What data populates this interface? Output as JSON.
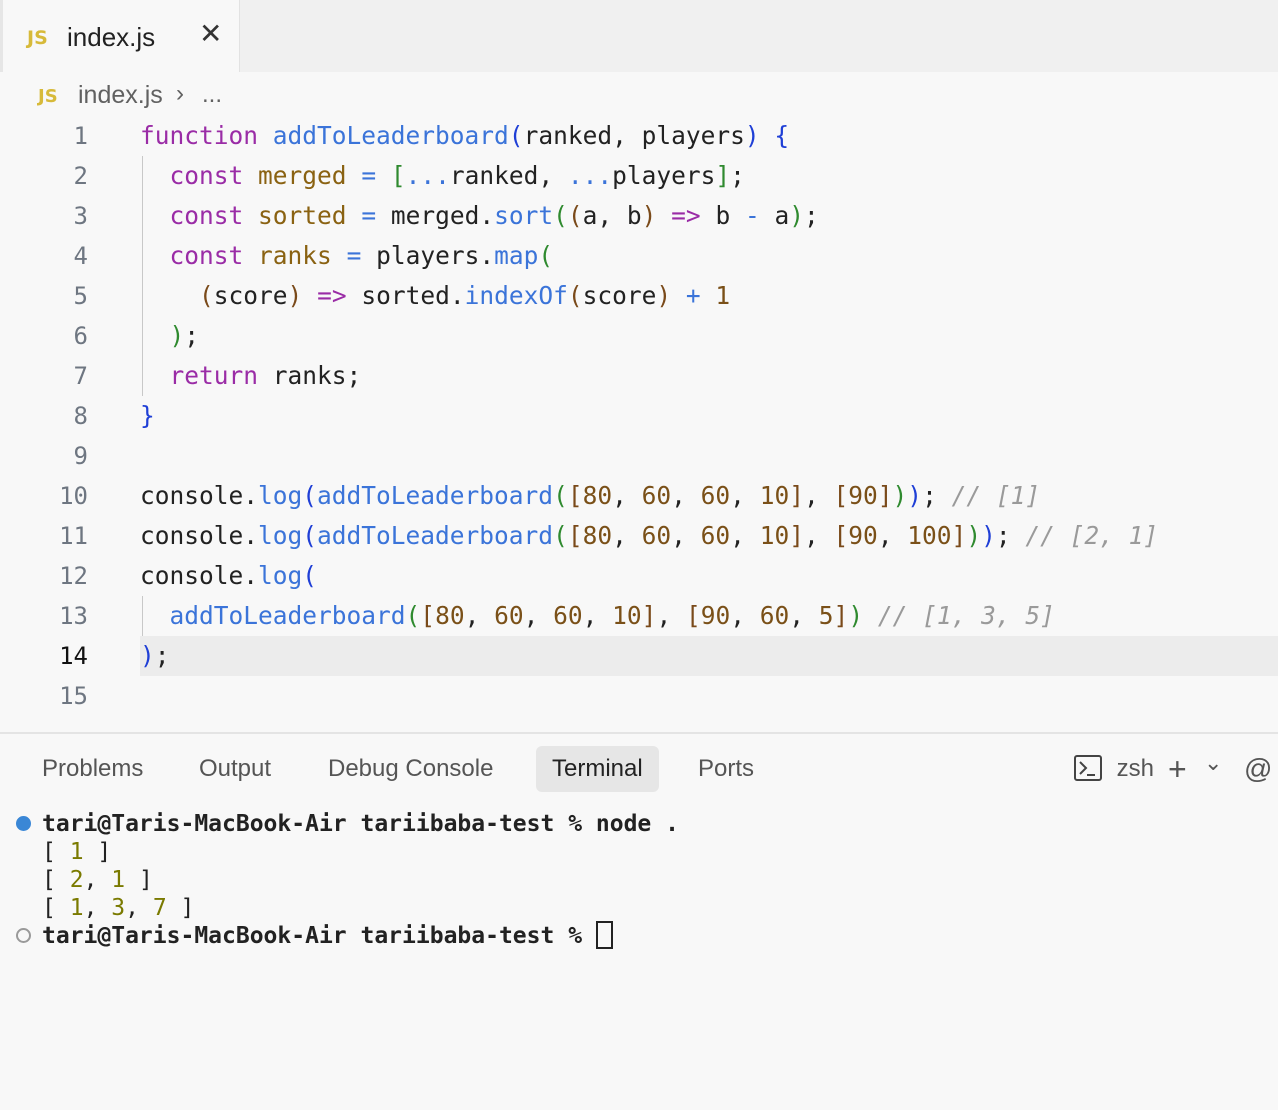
{
  "tab": {
    "badge": "JS",
    "label": "index.js",
    "close": "✕"
  },
  "breadcrumb": {
    "badge": "JS",
    "file": "index.js",
    "separator": "›",
    "more": "..."
  },
  "editor": {
    "active_line": "14",
    "lines": [
      {
        "n": "1"
      },
      {
        "n": "2"
      },
      {
        "n": "3"
      },
      {
        "n": "4"
      },
      {
        "n": "5"
      },
      {
        "n": "6"
      },
      {
        "n": "7"
      },
      {
        "n": "8"
      },
      {
        "n": "9"
      },
      {
        "n": "10"
      },
      {
        "n": "11"
      },
      {
        "n": "12"
      },
      {
        "n": "13"
      },
      {
        "n": "14"
      },
      {
        "n": "15"
      }
    ],
    "code": {
      "l1": {
        "kw": "function",
        "fn": "addToLeaderboard",
        "p1": "(",
        "args": "ranked, players",
        "p2": ")",
        "sp": " ",
        "b": "{"
      },
      "l2": {
        "kw": "const",
        "var": "merged",
        "eq": " = ",
        "b1": "[",
        "spread1": "...",
        "a1": "ranked, ",
        "spread2": "...",
        "a2": "players",
        "b2": "]",
        "end": ";"
      },
      "l3": {
        "kw": "const",
        "var": "sorted",
        "eq": " = ",
        "obj": "merged.",
        "fn": "sort",
        "p1": "(",
        "p2": "(",
        "args": "a, b",
        "p3": ")",
        "arrow": " => ",
        "expr1": "b ",
        "minus": "-",
        "expr2": " a",
        "p4": ")",
        "end": ";"
      },
      "l4": {
        "kw": "const",
        "var": "ranks",
        "eq": " = ",
        "obj": "players.",
        "fn": "map",
        "p1": "("
      },
      "l5": {
        "p1": "(",
        "arg": "score",
        "p2": ")",
        "arrow": " => ",
        "obj": "sorted.",
        "fn": "indexOf",
        "p3": "(",
        "arg2": "score",
        "p4": ")",
        "plus": " + ",
        "num": "1"
      },
      "l6": {
        "p": ")",
        "end": ";"
      },
      "l7": {
        "kw": "return",
        "rest": " ranks;"
      },
      "l8": {
        "b": "}"
      },
      "l10": {
        "obj": "console.",
        "fn": "log",
        "p1": "(",
        "fn2": "addToLeaderboard",
        "p2": "(",
        "b1": "[",
        "n1": "80",
        ", ": ", ",
        "n2": "60",
        "n3": "60",
        "n4": "10",
        "b2": "]",
        "b3": "[",
        "n5": "90",
        "b4": "]",
        "p3": ")",
        "p4": ")",
        "end": ";",
        "comment": "// [1]"
      },
      "l11": {
        "obj": "console.",
        "fn": "log",
        "p1": "(",
        "fn2": "addToLeaderboard",
        "p2": "(",
        "b1": "[",
        "n1": "80",
        "n2": "60",
        "n3": "60",
        "n4": "10",
        "b2": "]",
        "b3": "[",
        "n5": "90",
        "n6": "100",
        "b4": "]",
        "p3": ")",
        "p4": ")",
        "end": ";",
        "comment": "// [2, 1]"
      },
      "l12": {
        "obj": "console.",
        "fn": "log",
        "p1": "("
      },
      "l13": {
        "fn": "addToLeaderboard",
        "p1": "(",
        "b1": "[",
        "n1": "80",
        "n2": "60",
        "n3": "60",
        "n4": "10",
        "b2": "]",
        "b3": "[",
        "n5": "90",
        "n6": "60",
        "n7": "5",
        "b4": "]",
        "p2": ")",
        "comment": "// [1, 3, 5]"
      },
      "l14": {
        "p": ")",
        "end": ";"
      }
    }
  },
  "panel": {
    "tabs": [
      "Problems",
      "Output",
      "Debug Console",
      "Terminal",
      "Ports"
    ],
    "active_tab": "Terminal",
    "shell": "zsh",
    "add": "+",
    "chevron": "⌄",
    "at": "@"
  },
  "terminal": {
    "prompt1": "tari@Taris-MacBook-Air tariibaba-test % node .",
    "out1": {
      "open": "[ ",
      "v1": "1",
      "close": " ]"
    },
    "out2": {
      "open": "[ ",
      "v1": "2",
      "sep": ", ",
      "v2": "1",
      "close": " ]"
    },
    "out3": {
      "open": "[ ",
      "v1": "1",
      "sep": ", ",
      "v2": "3",
      "v3": "7",
      "close": " ]"
    },
    "prompt2": "tari@Taris-MacBook-Air tariibaba-test % "
  },
  "colors": {
    "dot_active": "#3a87d6",
    "dot_idle": "#9a9a9a",
    "js_badge": "#d7ba3a"
  }
}
